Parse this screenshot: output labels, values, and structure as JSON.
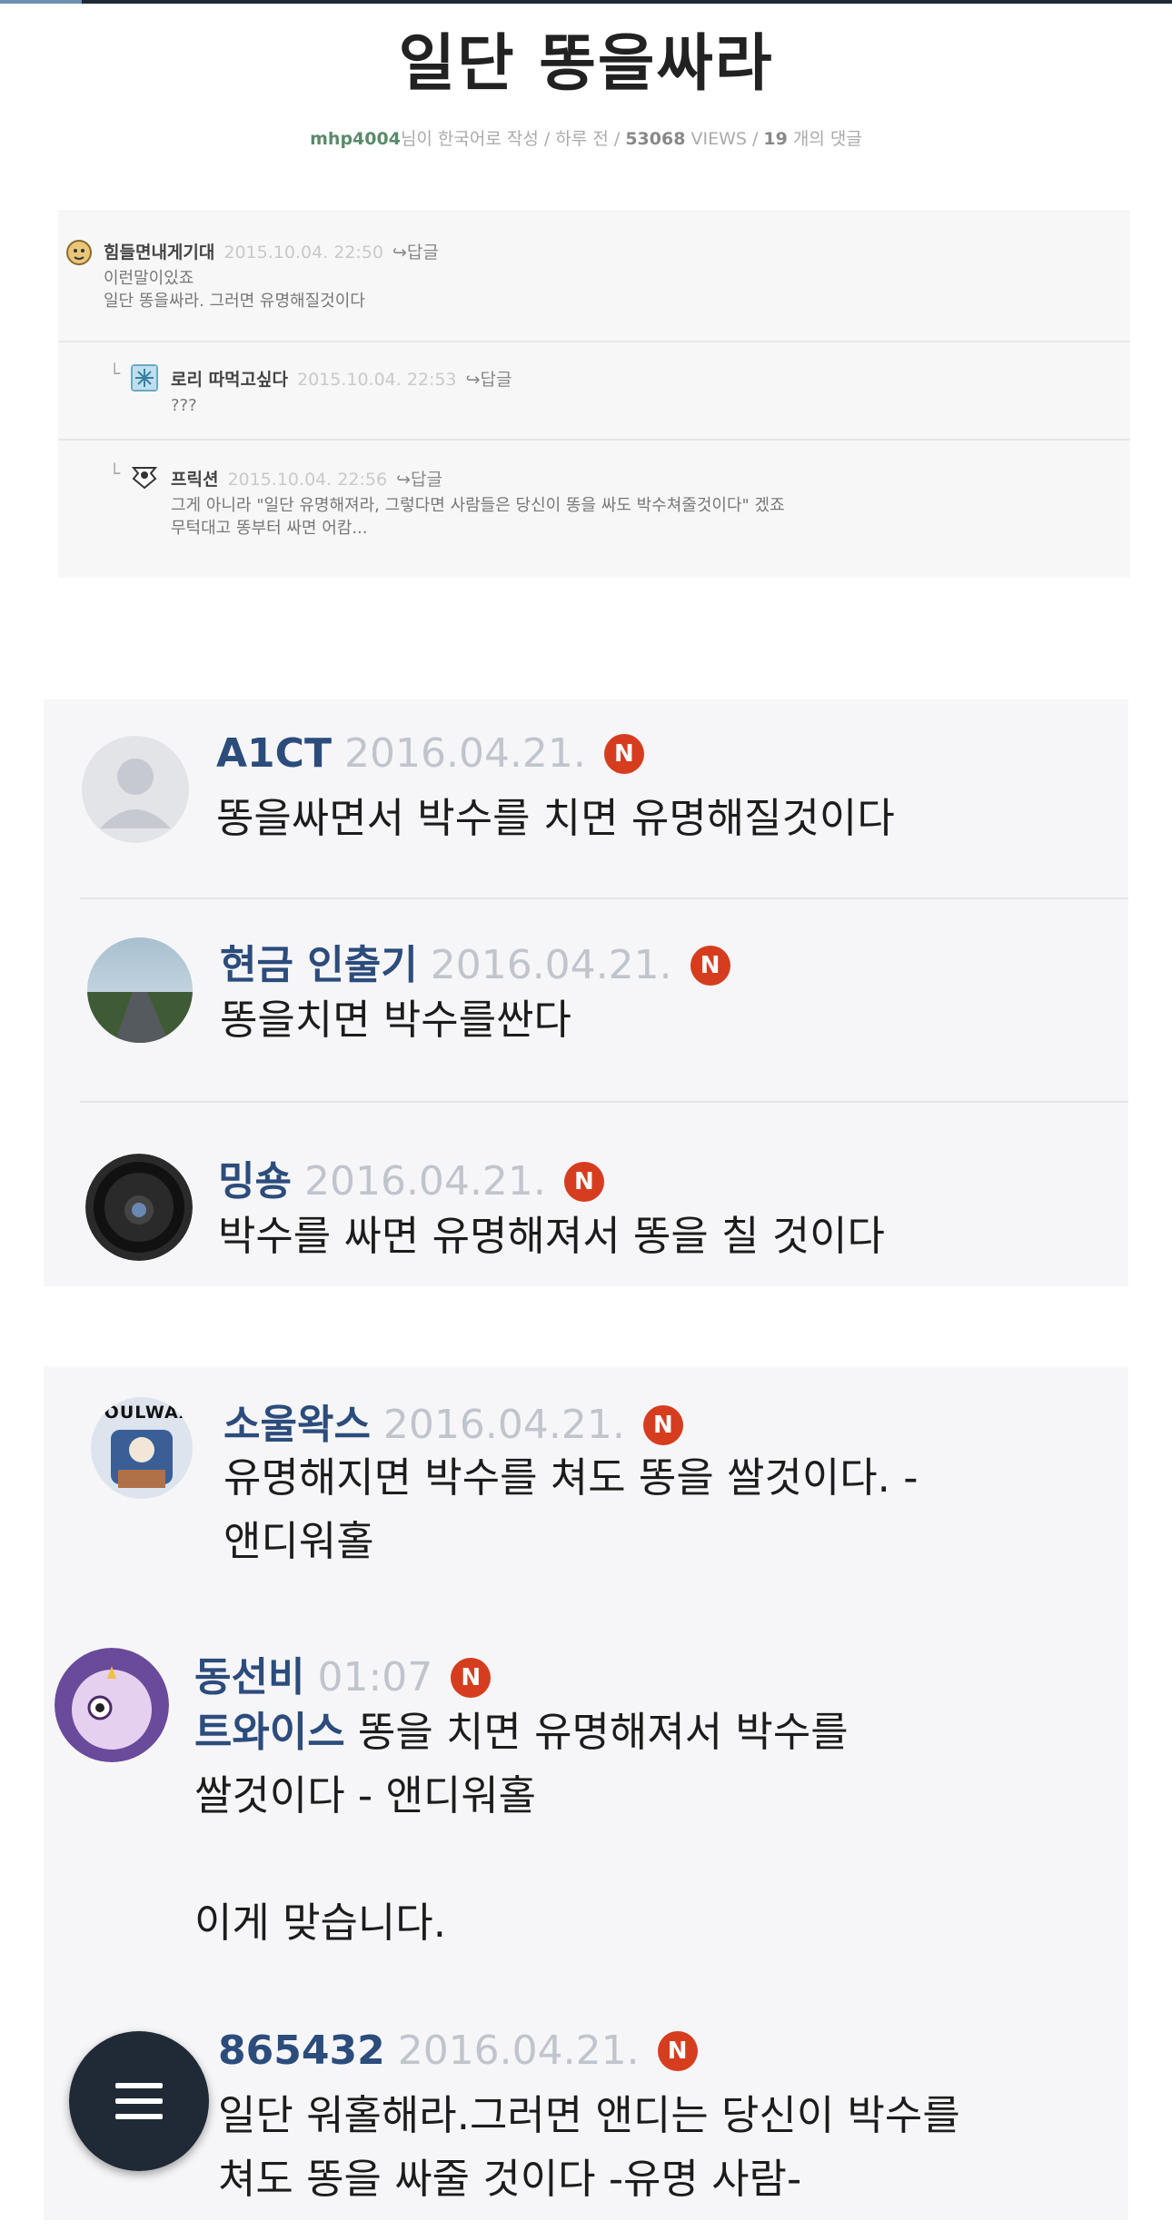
{
  "post": {
    "title": "일단 똥을싸라",
    "meta_author": "mhp4004",
    "meta_mid": "님이 한국어로 작성 / 하루 전 / ",
    "meta_views": "53068",
    "meta_views_label": " VIEWS / ",
    "meta_comments": "19",
    "meta_comments_label": " 개의 댓글"
  },
  "screenshot_comments": [
    {
      "nick": "힘들면내게기대",
      "date": "2015.10.04. 22:50",
      "reply": "↪답글",
      "lines": [
        "이런말이있죠",
        "일단 똥을싸라. 그러면 유명해질것이다"
      ]
    },
    {
      "nick": "로리 따먹고싶다",
      "date": "2015.10.04. 22:53",
      "reply": "↪답글",
      "lines": [
        "???"
      ]
    },
    {
      "nick": "프릭션",
      "date": "2015.10.04. 22:56",
      "reply": "↪답글",
      "lines": [
        "그게 아니라 \"일단 유명해져라, 그렇다면 사람들은 당신이 똥을 싸도 박수쳐줄것이다\" 겠죠",
        "무턱대고 똥부터 싸면 어캄..."
      ]
    }
  ],
  "badge_label": "N",
  "section1": [
    {
      "nick": "A1CT",
      "date": "2016.04.21.",
      "lines": [
        "똥을싸면서 박수를 치면 유명해질것이다"
      ]
    },
    {
      "nick": "현금 인출기",
      "date": "2016.04.21.",
      "lines": [
        "똥을치면 박수를싼다"
      ]
    },
    {
      "nick": "밍숑",
      "date": "2016.04.21.",
      "lines": [
        "박수를 싸면 유명해져서 똥을 칠 것이다"
      ]
    }
  ],
  "section2": [
    {
      "nick": "소울왁스",
      "date": "2016.04.21.",
      "avatar_text": "SOULWAX",
      "lines": [
        "유명해지면 박수를 쳐도 똥을 쌀것이다. -",
        "앤디워홀"
      ]
    },
    {
      "nick": "동선비",
      "date": "01:07",
      "mention": "트와이스",
      "line1_rest": " 똥을 치면 유명해져서 박수를",
      "line2": "쌀것이다 - 앤디워홀",
      "line3": "이게 맞습니다."
    },
    {
      "nick": "865432",
      "date": "2016.04.21.",
      "lines": [
        "일단 워홀해라.그러면 앤디는 당신이 박수를",
        "쳐도 똥을 싸줄 것이다 -유명 사람-"
      ]
    }
  ],
  "icons": {
    "menu": "menu-icon",
    "reply_arrow": "reply-arrow-icon",
    "default_avatar": "default-avatar-icon"
  },
  "colors": {
    "nick": "#2c4c7c",
    "badge": "#d63d1f",
    "fab": "#1f2a36"
  }
}
